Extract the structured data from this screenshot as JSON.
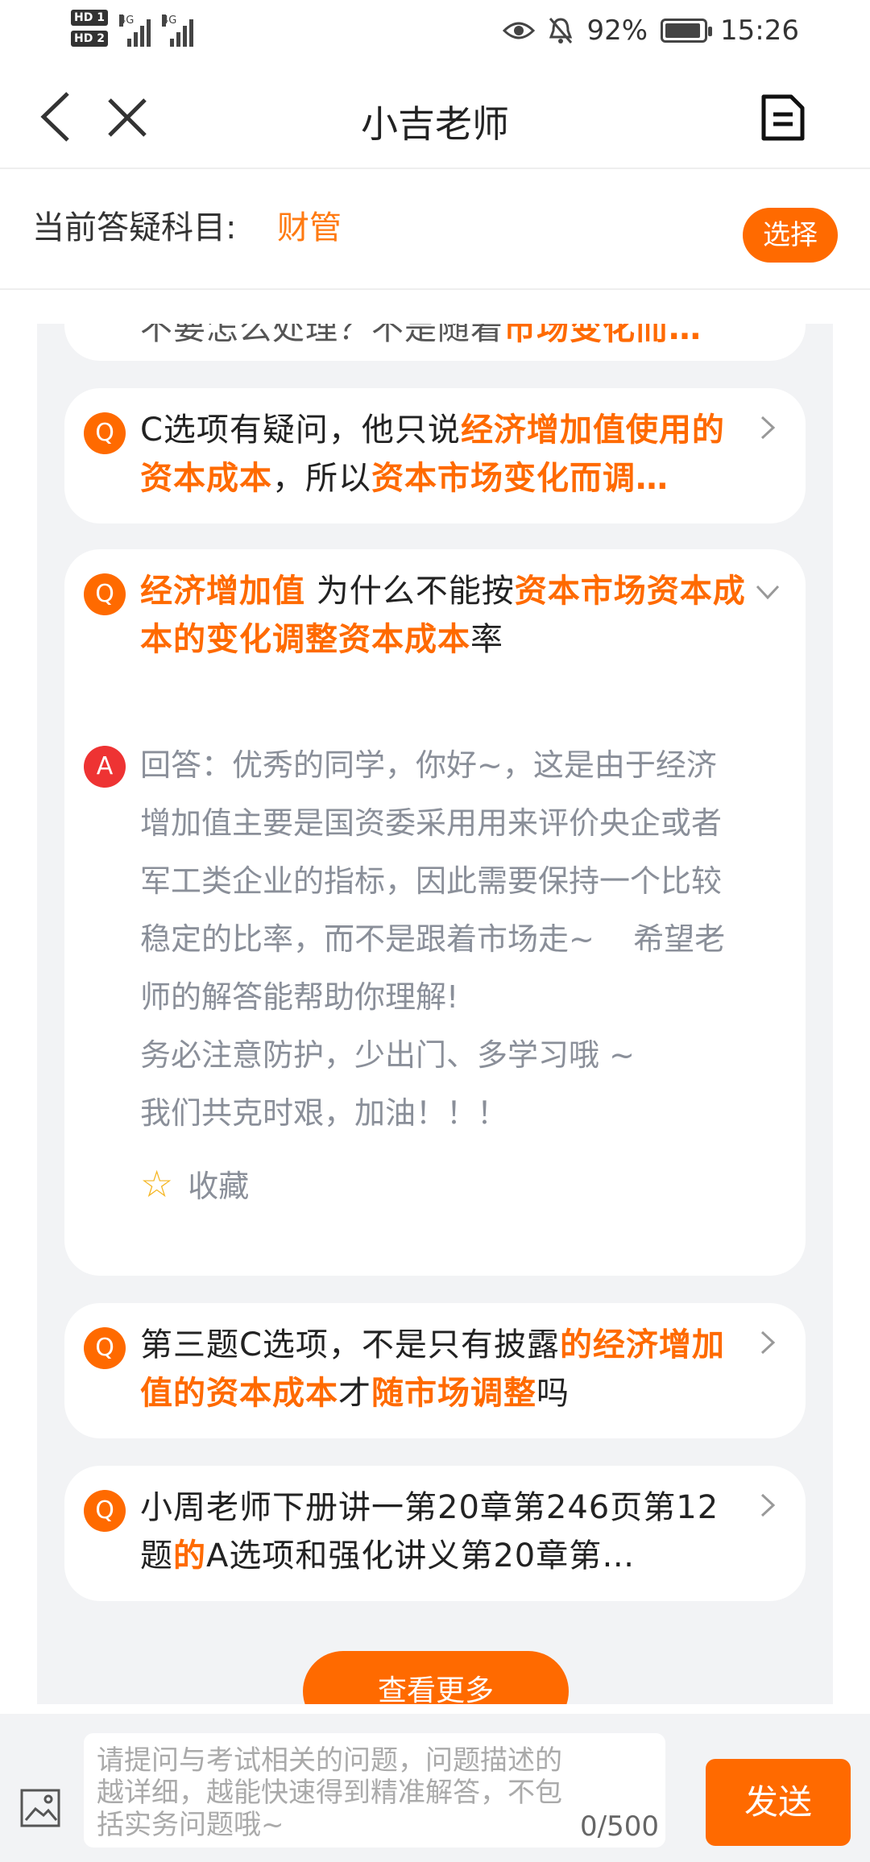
{
  "status_bar": {
    "hd1": "HD 1",
    "hd2": "HD 2",
    "net1": "4G",
    "net2": "4G",
    "battery": "92%",
    "battery_level": 0.92,
    "time": "15:26"
  },
  "nav": {
    "title": "小吉老师"
  },
  "subject": {
    "label": "当前答疑科目:",
    "value": "财管",
    "select_label": "选择"
  },
  "list": {
    "partial_top": {
      "text": "不要怎么处理？不是随着",
      "highlight": "市场变化而…"
    },
    "items": [
      {
        "badge": "Q",
        "parts": [
          {
            "t": "C选项有疑问，他只说"
          },
          {
            "t": "经济增加值使用的资本成本",
            "h": true
          },
          {
            "t": "，所以"
          },
          {
            "t": "资本市场变化而调…",
            "h": true
          }
        ]
      },
      {
        "badge": "Q",
        "parts": [
          {
            "t": "经济增加值",
            "h": true
          },
          {
            "t": " 为什么不能按"
          },
          {
            "t": "资本市场资本成本的变化调整资本成本",
            "h": true
          },
          {
            "t": "率"
          }
        ],
        "answer_badge": "A",
        "answer_lines": [
          "回答：优秀的同学，你好~，这是由于经济",
          "增加值主要是国资委采用用来评价央企或者",
          "军工类企业的指标，因此需要保持一个比较",
          "稳定的比率，而不是跟着市场走~    希望老",
          "师的解答能帮助你理解!",
          "务必注意防护，少出门、多学习哦 ~",
          "我们共克时艰，加油！！！"
        ],
        "favorite_label": "收藏"
      },
      {
        "badge": "Q",
        "parts": [
          {
            "t": "第三题C选项，不是只有披露"
          },
          {
            "t": "的经济增加值的资本成本",
            "h": true
          },
          {
            "t": "才"
          },
          {
            "t": "随市场调整",
            "h": true
          },
          {
            "t": "吗"
          }
        ]
      },
      {
        "badge": "Q",
        "parts": [
          {
            "t": "小周老师下册讲一第20章第246页第12题"
          },
          {
            "t": "的",
            "h": true
          },
          {
            "t": "A选项和强化讲义第20章第…"
          }
        ]
      }
    ],
    "more_label": "查看更多"
  },
  "composer": {
    "placeholder": "请提问与考试相关的问题，问题描述的越详细，越能快速得到精准解答，不包括实务问题哦~",
    "counter": "0/500",
    "send_label": "发送"
  }
}
